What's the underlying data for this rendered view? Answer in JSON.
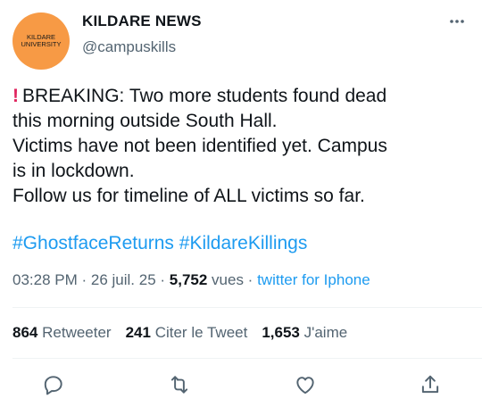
{
  "profile": {
    "name": "KILDARE NEWS",
    "handle": "@campuskills",
    "avatar_text_line1": "KILDARE",
    "avatar_text_line2": "UNIVERSITY",
    "avatar_color": "#f79a45"
  },
  "more_icon": "more-options-icon",
  "tweet": {
    "alert_icon": "!",
    "line1": "BREAKING: Two more students found dead",
    "line2": "this morning outside South Hall.",
    "line3": "Victims have not been identified yet. Campus",
    "line4": "is in lockdown.",
    "line5": "Follow us for timeline of ALL victims so far.",
    "hashtags": "#GhostfaceReturns #KildareKillings"
  },
  "meta": {
    "time": "03:28 PM",
    "sep1": " · ",
    "date": "26 juil. 25",
    "sep2": " · ",
    "views": "5,752",
    "views_label": " vues",
    "sep3": " · ",
    "source": "twitter for Iphone"
  },
  "stats": {
    "retweets": "864",
    "retweets_label": "Retweeter",
    "quotes": "241",
    "quotes_label": "Citer le Tweet",
    "likes": "1,653",
    "likes_label": "J'aime"
  },
  "actions": {
    "reply": "reply-icon",
    "retweet": "retweet-icon",
    "like": "like-icon",
    "share": "share-icon"
  },
  "colors": {
    "link": "#1d9bf0",
    "secondary": "#536471",
    "alert": "#e0245e"
  }
}
